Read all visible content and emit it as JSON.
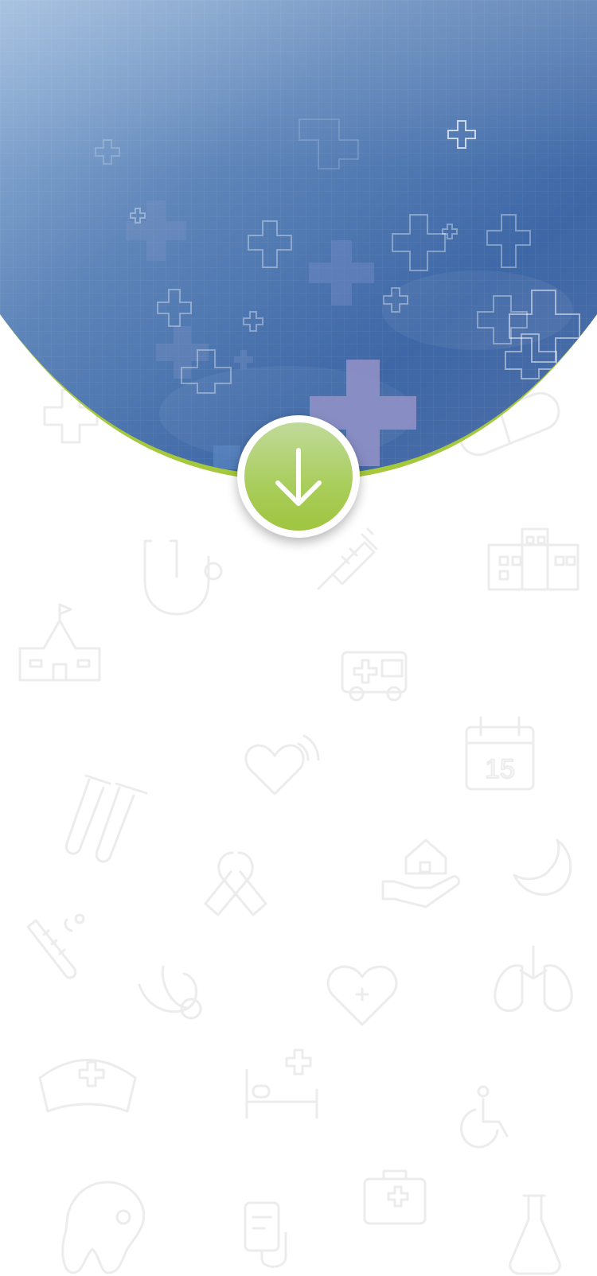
{
  "hero": {
    "accent_color": "#a6c83c",
    "gradient_colors": [
      "#8eb0d8",
      "#5d85b8",
      "#3f6aa9",
      "#3560a3"
    ]
  },
  "scroll_button": {
    "icon": "arrow-down-icon",
    "colors": [
      "#bfda9a",
      "#a6cb52"
    ]
  },
  "background_icons": [
    "plus-icon",
    "pill-icon",
    "stethoscope-icon",
    "syringe-icon",
    "hospital-building-icon",
    "school-icon",
    "ambulance-icon",
    "calendar-icon",
    "heart-signal-icon",
    "test-tubes-icon",
    "awareness-ribbon-icon",
    "home-care-icon",
    "moon-icon",
    "thermometer-icon",
    "stethoscope-small-icon",
    "heart-plus-icon",
    "lungs-icon",
    "nurse-cap-icon",
    "hospital-bed-icon",
    "wheelchair-icon",
    "tooth-icon",
    "iv-bag-icon",
    "first-aid-kit-icon",
    "flask-icon"
  ],
  "calendar_day": "15"
}
